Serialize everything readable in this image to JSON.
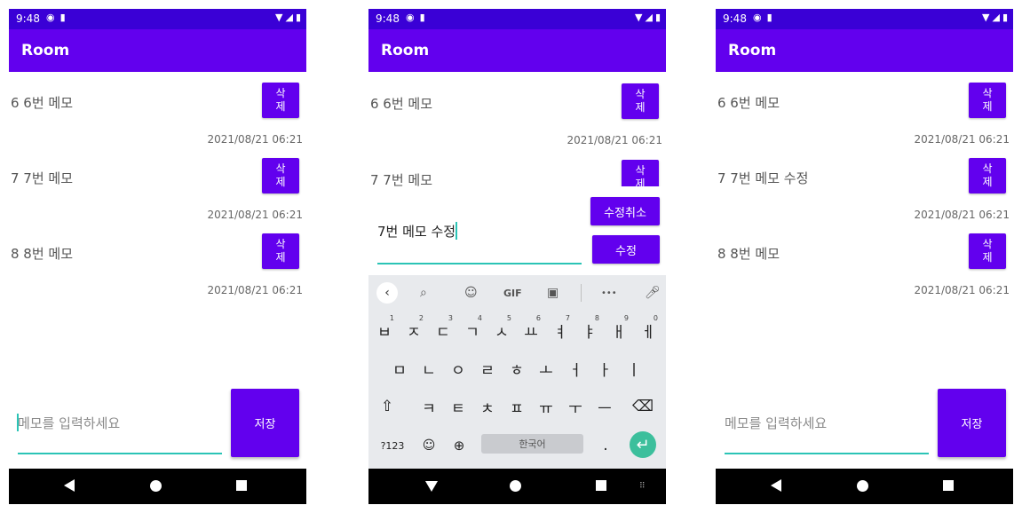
{
  "status": {
    "time": "9:48",
    "icons": [
      "@",
      "▮",
      "▼",
      "◢",
      "▮"
    ]
  },
  "app_title": "Room",
  "colors": {
    "primary": "#6200ee",
    "status": "#3a00d6",
    "accent": "#2bc4b6"
  },
  "phone1": {
    "memos": [
      {
        "text": "6 6번 메모",
        "date": "2021/08/21 06:21",
        "delete_label": [
          "삭",
          "제"
        ]
      },
      {
        "text": "7 7번 메모",
        "date": "2021/08/21 06:21",
        "delete_label": [
          "삭",
          "제"
        ]
      },
      {
        "text": "8 8번 메모",
        "date": "2021/08/21 06:21",
        "delete_label": [
          "삭",
          "제"
        ]
      }
    ],
    "input_placeholder": "메모를 입력하세요",
    "save_label": "저장"
  },
  "phone2": {
    "memos": [
      {
        "text": "6 6번 메모",
        "date": "2021/08/21 06:21",
        "delete_label": [
          "삭",
          "제"
        ]
      },
      {
        "text": "7 7번 메모",
        "delete_label": [
          "삭",
          "제"
        ]
      }
    ],
    "edit_value": "7번 메모 수정",
    "cancel_label": "수정취소",
    "confirm_label": "수정",
    "keyboard": {
      "row1": [
        {
          "key": "ㅂ",
          "num": "1"
        },
        {
          "key": "ㅈ",
          "num": "2"
        },
        {
          "key": "ㄷ",
          "num": "3"
        },
        {
          "key": "ㄱ",
          "num": "4"
        },
        {
          "key": "ㅅ",
          "num": "5"
        },
        {
          "key": "ㅛ",
          "num": "6"
        },
        {
          "key": "ㅕ",
          "num": "7"
        },
        {
          "key": "ㅑ",
          "num": "8"
        },
        {
          "key": "ㅐ",
          "num": "9"
        },
        {
          "key": "ㅔ",
          "num": "0"
        }
      ],
      "row2": [
        "ㅁ",
        "ㄴ",
        "ㅇ",
        "ㄹ",
        "ㅎ",
        "ㅗ",
        "ㅓ",
        "ㅏ",
        "ㅣ"
      ],
      "row3": [
        "ㅋ",
        "ㅌ",
        "ㅊ",
        "ㅍ",
        "ㅠ",
        "ㅜ",
        "ㅡ"
      ],
      "sym_label": "?123",
      "space_label": "한국어",
      "period": ".",
      "toolbar_gif": "GIF",
      "toolbar_more": "•••"
    }
  },
  "phone3": {
    "memos": [
      {
        "text": "6 6번 메모",
        "date": "2021/08/21 06:21",
        "delete_label": [
          "삭",
          "제"
        ]
      },
      {
        "text": "7 7번 메모 수정",
        "date": "2021/08/21 06:21",
        "delete_label": [
          "삭",
          "제"
        ]
      },
      {
        "text": "8 8번 메모",
        "date": "2021/08/21 06:21",
        "delete_label": [
          "삭",
          "제"
        ]
      }
    ],
    "input_placeholder": "메모를 입력하세요",
    "save_label": "저장"
  }
}
